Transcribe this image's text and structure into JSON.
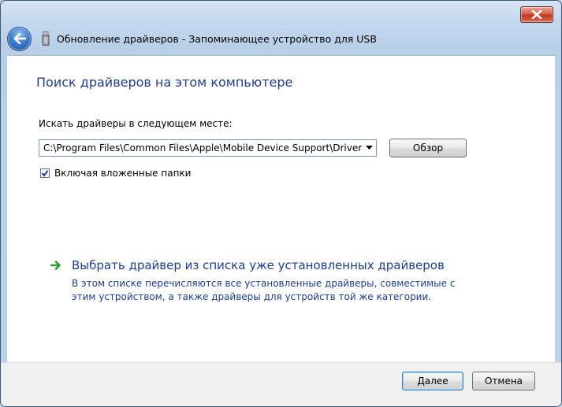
{
  "window": {
    "title": "Обновление драйверов - Запоминающее устройство для USB"
  },
  "main": {
    "heading": "Поиск драйверов на этом компьютере",
    "search_label": "Искать драйверы в следующем месте:",
    "path_value": "C:\\Program Files\\Common Files\\Apple\\Mobile Device Support\\Drivers",
    "browse_label": "Обзор",
    "include_subfolders_label": "Включая вложенные папки",
    "include_subfolders_checked": true,
    "pick_link_title": "Выбрать драйвер из списка уже установленных драйверов",
    "pick_link_description": "В этом списке перечисляются все установленные драйверы, совместимые с этим устройством, а также драйверы для устройств той же категории."
  },
  "footer": {
    "next_label": "Далее",
    "cancel_label": "Отмена"
  },
  "icons": {
    "close": "close-icon",
    "back": "back-arrow-icon",
    "device": "usb-device-icon",
    "dropdown": "chevron-down-icon",
    "link": "green-arrow-icon",
    "check": "checkmark-icon"
  },
  "colors": {
    "accent_text": "#1e3d8f",
    "close_button": "#c2331d",
    "link_arrow": "#2e9b2e"
  }
}
